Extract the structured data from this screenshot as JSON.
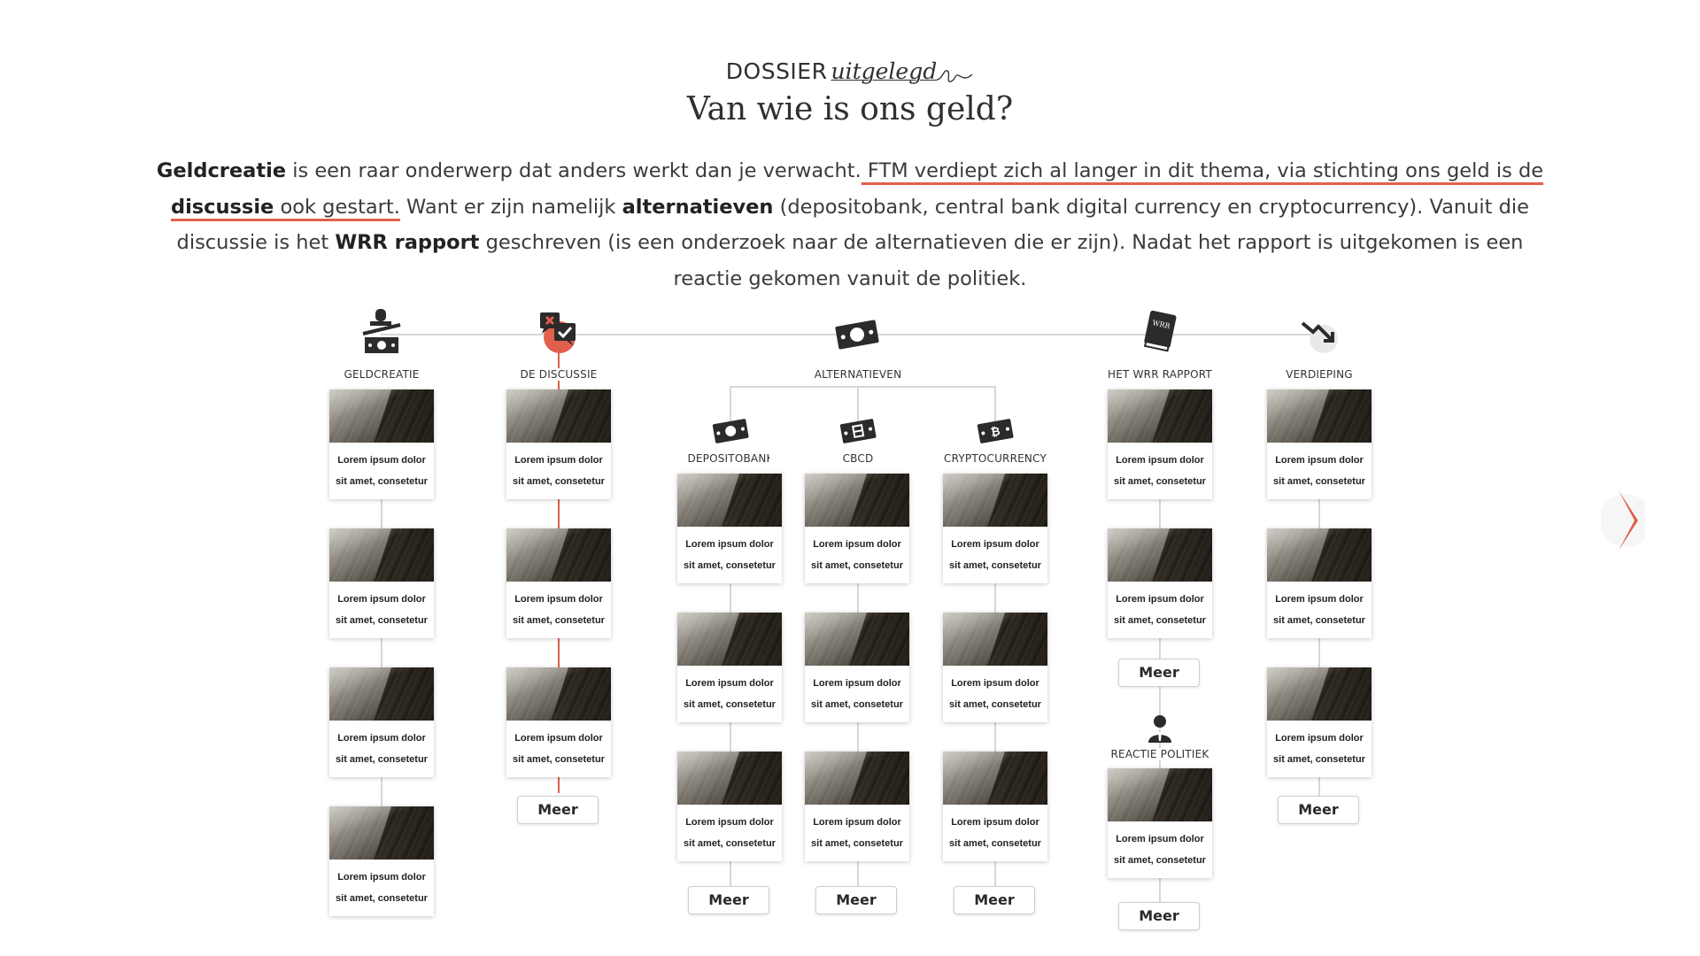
{
  "header": {
    "kicker_main": "DOSSIER",
    "kicker_script": "uitgelegd",
    "title": "Van wie is ons geld?"
  },
  "intro": {
    "p1_bold": "Geldcreatie",
    "p2": " is een raar onderwerp dat anders werkt dan je verwacht.",
    "p3_link": " FTM verdiept zich al langer in dit thema, via stichting ons geld is de ",
    "p4_link_bold": "discussie",
    "p5_link": " ook gestart.",
    "p6": " Want er zijn namelijk ",
    "p7_bold": "alternatieven",
    "p8": " (depositobank, central bank digital currency en cryptocurrency). Vanuit die discussie is het ",
    "p9_bold": "WRR rapport",
    "p10": " geschreven (is een onderzoek naar de alternatieven die er zijn). Nadat het rapport is uitgekomen is een reactie gekomen vanuit de politiek."
  },
  "card": {
    "line1": "Lorem ipsum dolor",
    "line2": "sit amet, consetetur"
  },
  "nodes": {
    "geldcreatie": "GELDCREATIE",
    "discussie": "DE DISCUSSIE",
    "alternatieven": "ALTERNATIEVEN",
    "depositobank": "DEPOSITOBANK",
    "cbcd": "CBCD",
    "crypto": "CRYPTOCURRENCY",
    "wrr": "HET WRR RAPPORT",
    "verdieping": "VERDIEPING",
    "politiek": "REACTIE POLITIEK"
  },
  "buttons": {
    "meer": "Meer"
  },
  "icons": {
    "geldcreatie": "money-stamp-icon",
    "discussie": "chat-bubbles-icon",
    "alternatieven": "banknote-icon",
    "depositobank": "deposit-note-icon",
    "cbcd": "digital-note-icon",
    "crypto": "bitcoin-note-icon",
    "wrr": "book-icon",
    "verdieping": "trend-down-icon",
    "politiek": "politician-icon",
    "next": "chevron-right-icon"
  },
  "colors": {
    "accent": "#e0604c",
    "line": "#d7d7d7",
    "icon": "#2b2b2b"
  }
}
